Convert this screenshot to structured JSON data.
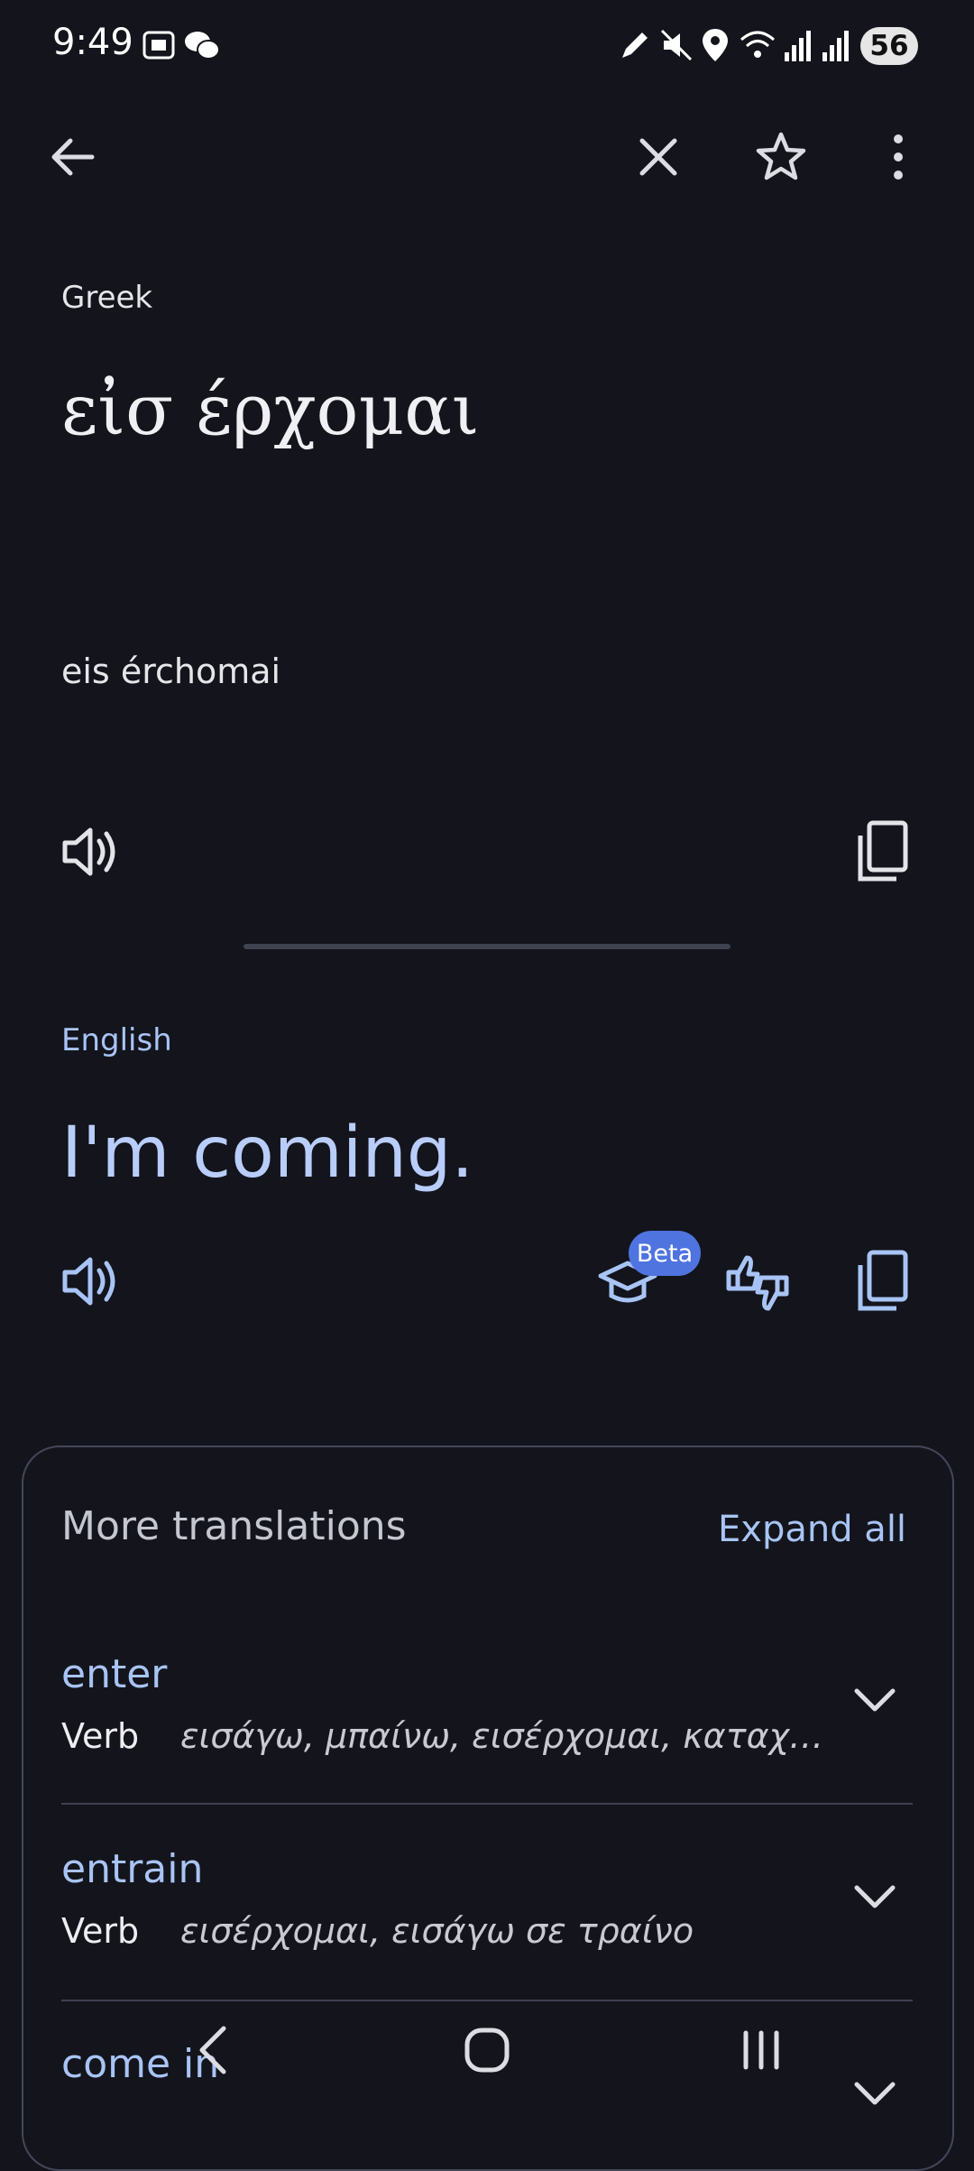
{
  "status_bar": {
    "time": "9:49",
    "battery": "56",
    "icons": [
      "screenshot-icon",
      "wechat-icon",
      "pen-icon",
      "mute-icon",
      "location-icon",
      "wifi-icon",
      "signal-icon",
      "signal-icon"
    ]
  },
  "toolbar": {
    "icons": [
      "back-arrow-icon",
      "close-icon",
      "star-icon",
      "more-vert-icon"
    ]
  },
  "source": {
    "language": "Greek",
    "text": "εἰσ έρχομαι",
    "transliteration": "eis érchomai"
  },
  "target": {
    "language": "English",
    "text": "I'm coming.",
    "beta_label": "Beta"
  },
  "more_translations": {
    "title": "More translations",
    "expand_all": "Expand all",
    "entries": [
      {
        "word": "enter",
        "pos": "Verb",
        "translations": "εισάγω, μπαίνω, εισέρχομαι, καταχωρί..."
      },
      {
        "word": "entrain",
        "pos": "Verb",
        "translations": "εισέρχομαι, εισάγω σε τραίνο"
      },
      {
        "word": "come in",
        "pos": "",
        "translations": ""
      }
    ]
  },
  "colors": {
    "background": "#13141c",
    "accent": "#a8c4f5",
    "beta_badge": "#4f74e0"
  }
}
